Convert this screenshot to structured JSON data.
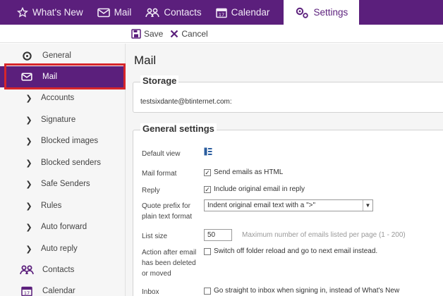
{
  "nav": {
    "whats_new": "What's New",
    "mail": "Mail",
    "contacts": "Contacts",
    "calendar": "Calendar",
    "settings": "Settings"
  },
  "toolbar": {
    "save": "Save",
    "cancel": "Cancel"
  },
  "sidebar": {
    "items": [
      {
        "label": "General"
      },
      {
        "label": "Mail"
      },
      {
        "label": "Accounts"
      },
      {
        "label": "Signature"
      },
      {
        "label": "Blocked images"
      },
      {
        "label": "Blocked senders"
      },
      {
        "label": "Safe Senders"
      },
      {
        "label": "Rules"
      },
      {
        "label": "Auto forward"
      },
      {
        "label": "Auto reply"
      },
      {
        "label": "Contacts"
      },
      {
        "label": "Calendar"
      }
    ]
  },
  "main": {
    "title": "Mail",
    "storage": {
      "legend": "Storage",
      "account": "testsixdante@btinternet.com:"
    },
    "general": {
      "legend": "General settings",
      "default_view_label": "Default view",
      "mail_format_label": "Mail format",
      "mail_format_option": "Send emails as HTML",
      "mail_format_checked": true,
      "reply_label": "Reply",
      "reply_option": "Include original email in reply",
      "reply_checked": true,
      "quote_prefix_label": "Quote prefix for plain text format",
      "quote_prefix_value": "Indent original email text with a \">\"",
      "list_size_label": "List size",
      "list_size_value": "50",
      "list_size_hint": "Maximum number of emails listed per page (1 - 200)",
      "after_delete_label": "Action after email has been deleted or moved",
      "after_delete_option": "Switch off folder reload and go to next email instead.",
      "after_delete_checked": false,
      "inbox_label": "Inbox",
      "inbox_option": "Go straight to inbox when signing in, instead of What's New",
      "inbox_checked": false
    }
  },
  "colors": {
    "brand_purple": "#5b1f7c",
    "highlight_red": "#d7262b"
  }
}
